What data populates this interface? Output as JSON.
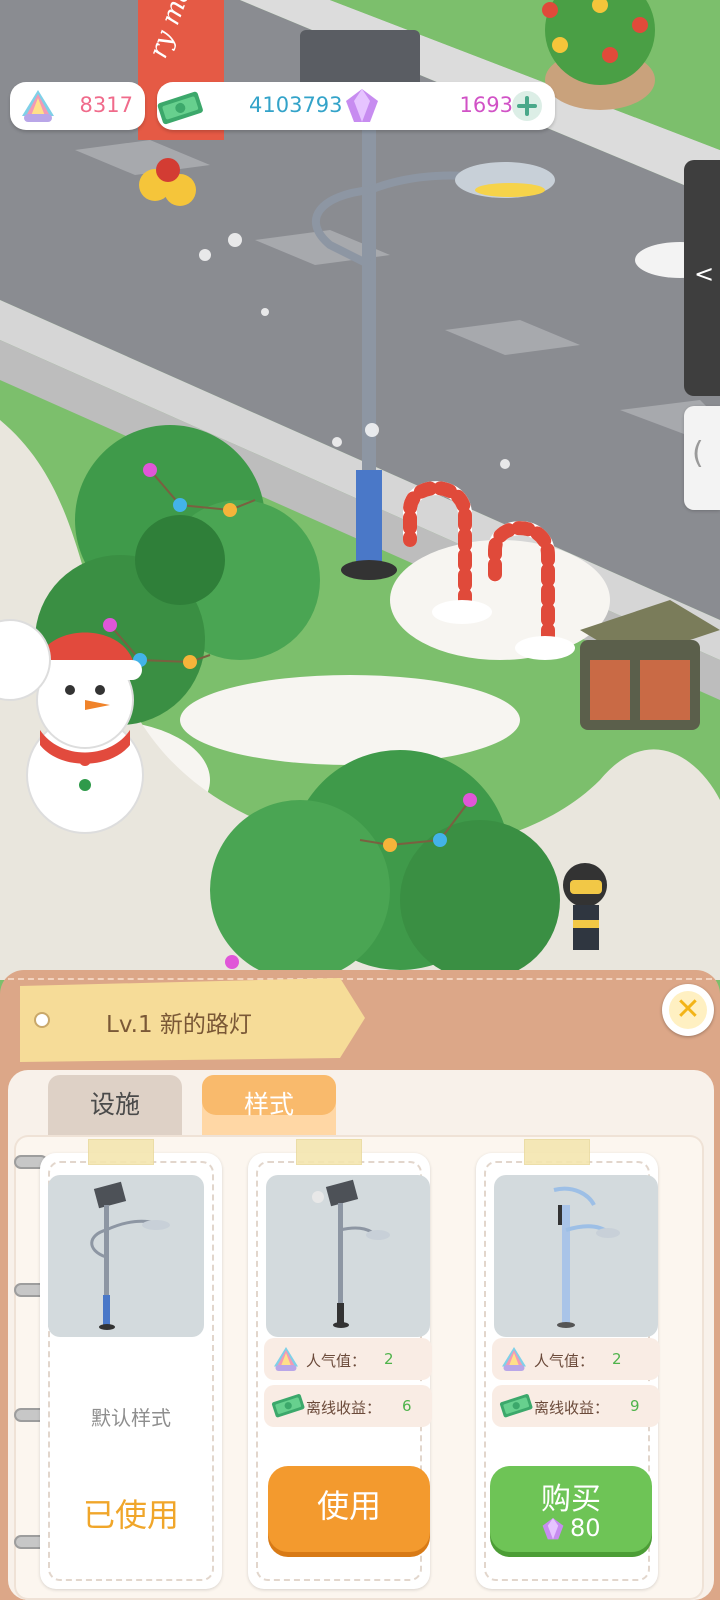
{
  "currency": {
    "shells": "8317",
    "cash": "4103793",
    "gems": "1693"
  },
  "side_tabs": {
    "collapse_glyph": "<",
    "expand_glyph": "("
  },
  "panel": {
    "title": "Lv.1 新的路灯",
    "close_glyph": "✕",
    "tabs": [
      {
        "label": "设施",
        "active": false
      },
      {
        "label": "样式",
        "active": true
      }
    ]
  },
  "styles": [
    {
      "name": "默认样式",
      "status": "已使用"
    },
    {
      "stats": [
        {
          "label": "人气值：",
          "value": "2",
          "icon": "shell-icon"
        },
        {
          "label": "离线收益：",
          "value": "6",
          "icon": "cash-icon"
        }
      ],
      "action": "使用"
    },
    {
      "stats": [
        {
          "label": "人气值：",
          "value": "2",
          "icon": "shell-icon"
        },
        {
          "label": "离线收益：",
          "value": "9",
          "icon": "cash-icon"
        }
      ],
      "action": "购买",
      "price": "80",
      "price_icon": "gem-icon"
    }
  ],
  "colors": {
    "shell": "#f06b8b",
    "cash": "#33a3c9",
    "gem": "#d152c6",
    "use_button": "#f39a2e",
    "buy_button": "#6ec456",
    "used_text": "#f0a62a"
  }
}
